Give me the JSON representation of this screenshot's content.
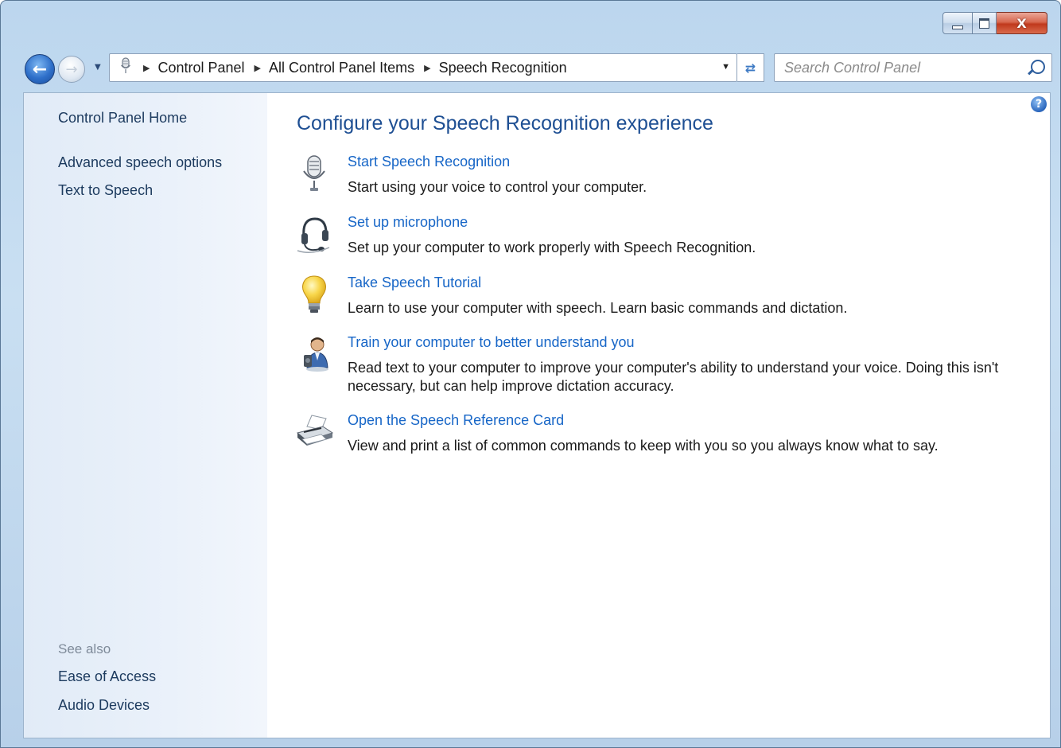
{
  "window": {
    "caption": {
      "minimize_label": "minimize",
      "maximize_label": "maximize",
      "close_glyph": "X"
    }
  },
  "navbar": {
    "back_icon": "back-arrow-icon",
    "forward_icon": "forward-arrow-icon",
    "breadcrumb": [
      "Control Panel",
      "All Control Panel Items",
      "Speech Recognition"
    ],
    "search_placeholder": "Search Control Panel"
  },
  "sidebar": {
    "home": "Control Panel Home",
    "links": [
      "Advanced speech options",
      "Text to Speech"
    ],
    "see_also_heading": "See also",
    "see_also": [
      "Ease of Access",
      "Audio Devices"
    ]
  },
  "main": {
    "title": "Configure your Speech Recognition experience",
    "tasks": [
      {
        "icon": "microphone-icon",
        "link": "Start Speech Recognition",
        "description": "Start using your voice to control your computer."
      },
      {
        "icon": "headset-icon",
        "link": "Set up microphone",
        "description": "Set up your computer to work properly with Speech Recognition."
      },
      {
        "icon": "lightbulb-icon",
        "link": "Take Speech Tutorial",
        "description": "Learn to use your computer with speech.  Learn basic commands and dictation."
      },
      {
        "icon": "user-training-icon",
        "link": "Train your computer to better understand you",
        "description": "Read text to your computer to improve your computer's ability to understand your voice.  Doing this isn't necessary, but can help improve dictation accuracy."
      },
      {
        "icon": "printer-icon",
        "link": "Open the Speech Reference Card",
        "description": "View and print a list of common commands to keep with you so you always know what to say."
      }
    ]
  },
  "colors": {
    "link": "#1766c7",
    "title": "#1e4f93",
    "sidebar_text": "#1c3a5e",
    "close_button": "#c0391c"
  }
}
